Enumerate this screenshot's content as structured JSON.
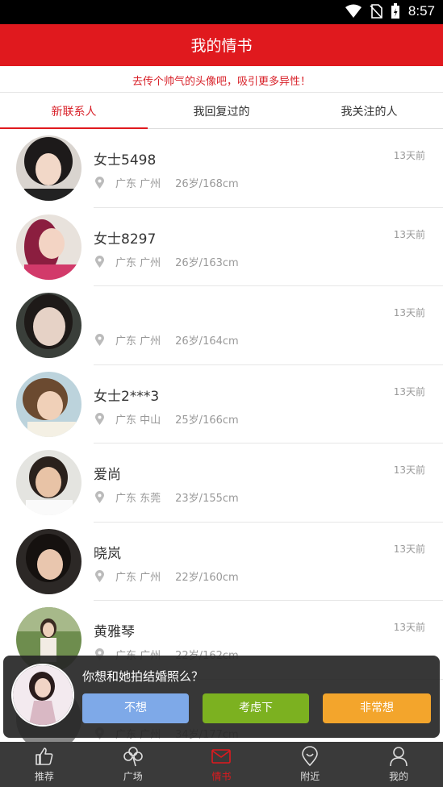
{
  "status_bar": {
    "time": "8:57",
    "icons": [
      "wifi-icon",
      "no-sim-icon",
      "battery-icon"
    ]
  },
  "header": {
    "title": "我的情书"
  },
  "notice": {
    "text": "去传个帅气的头像吧，吸引更多异性！"
  },
  "tabs": [
    {
      "label": "新联系人",
      "active": true
    },
    {
      "label": "我回复过的",
      "active": false
    },
    {
      "label": "我关注的人",
      "active": false
    }
  ],
  "contacts": [
    {
      "name": "女士5498",
      "time": "13天前",
      "city": "广东 广州",
      "info": "26岁/168cm"
    },
    {
      "name": "女士8297",
      "time": "13天前",
      "city": "广东 广州",
      "info": "26岁/163cm"
    },
    {
      "name": "",
      "time": "13天前",
      "city": "广东 广州",
      "info": "26岁/164cm"
    },
    {
      "name": "女士2***3",
      "time": "13天前",
      "city": "广东 中山",
      "info": "25岁/166cm"
    },
    {
      "name": "爱尚",
      "time": "13天前",
      "city": "广东 东莞",
      "info": "23岁/155cm"
    },
    {
      "name": "晓岚",
      "time": "13天前",
      "city": "广东 广州",
      "info": "22岁/160cm"
    },
    {
      "name": "黄雅琴",
      "time": "13天前",
      "city": "广东 广州",
      "info": "22岁/162cm"
    },
    {
      "name": "",
      "time": "",
      "city": "广东 广州",
      "info": "34岁/177cm"
    }
  ],
  "popup": {
    "question": "你想和她拍结婚照么？",
    "buttons": {
      "no": "不想",
      "maybe": "考虑下",
      "yes": "非常想"
    }
  },
  "bottom_nav": [
    {
      "label": "推荐",
      "icon": "thumbs-up-icon",
      "active": false
    },
    {
      "label": "广场",
      "icon": "clover-icon",
      "active": false
    },
    {
      "label": "情书",
      "icon": "envelope-icon",
      "active": true
    },
    {
      "label": "附近",
      "icon": "location-pin-icon",
      "active": false
    },
    {
      "label": "我的",
      "icon": "user-icon",
      "active": false
    }
  ],
  "colors": {
    "brand": "#e0191e",
    "no": "#7ea9e8",
    "maybe": "#7cb120",
    "yes": "#f3a52c",
    "nav_bg": "#3a3a3a"
  }
}
